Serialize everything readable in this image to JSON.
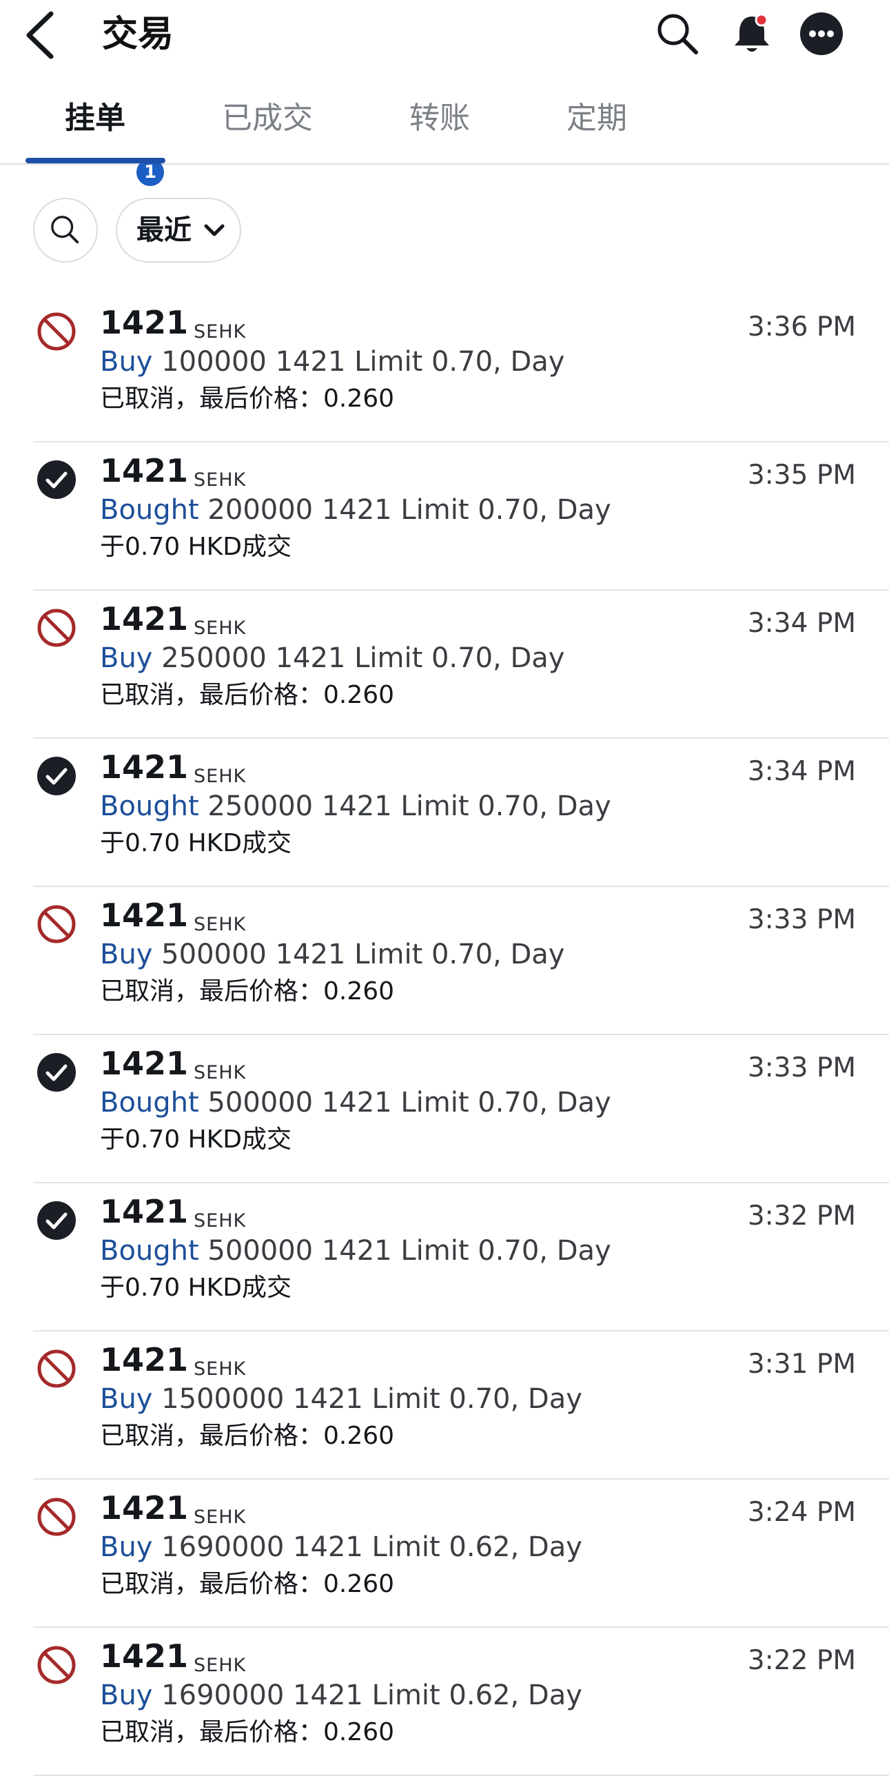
{
  "header": {
    "title": "交易"
  },
  "tabs": [
    {
      "label": "挂单",
      "active": true,
      "badge": "1"
    },
    {
      "label": "已成交",
      "active": false
    },
    {
      "label": "转账",
      "active": false
    },
    {
      "label": "定期",
      "active": false
    }
  ],
  "filters": {
    "period_label": "最近"
  },
  "colors": {
    "accent_blue": "#1c4f9a",
    "cancelled_red": "#a52a2a",
    "filled_black": "#1b1e24",
    "badge_blue": "#1c5fc4"
  },
  "icons": {
    "back": "chevron-left-icon",
    "search": "search-icon",
    "bell": "bell-icon",
    "more": "more-dots-icon",
    "cancelled": "prohibited-icon",
    "filled": "check-circle-icon"
  },
  "orders": [
    {
      "status": "cancelled",
      "symbol": "1421",
      "exchange": "SEHK",
      "time": "3:36 PM",
      "action": "Buy",
      "details": " 100000 1421 Limit 0.70, Day",
      "note": "已取消，最后价格：0.260"
    },
    {
      "status": "filled",
      "symbol": "1421",
      "exchange": "SEHK",
      "time": "3:35 PM",
      "action": "Bought",
      "details": " 200000 1421 Limit 0.70, Day",
      "note": "于0.70 HKD成交"
    },
    {
      "status": "cancelled",
      "symbol": "1421",
      "exchange": "SEHK",
      "time": "3:34 PM",
      "action": "Buy",
      "details": " 250000 1421 Limit 0.70, Day",
      "note": "已取消，最后价格：0.260"
    },
    {
      "status": "filled",
      "symbol": "1421",
      "exchange": "SEHK",
      "time": "3:34 PM",
      "action": "Bought",
      "details": " 250000 1421 Limit 0.70, Day",
      "note": "于0.70 HKD成交"
    },
    {
      "status": "cancelled",
      "symbol": "1421",
      "exchange": "SEHK",
      "time": "3:33 PM",
      "action": "Buy",
      "details": " 500000 1421 Limit 0.70, Day",
      "note": "已取消，最后价格：0.260"
    },
    {
      "status": "filled",
      "symbol": "1421",
      "exchange": "SEHK",
      "time": "3:33 PM",
      "action": "Bought",
      "details": " 500000 1421 Limit 0.70, Day",
      "note": "于0.70 HKD成交"
    },
    {
      "status": "filled",
      "symbol": "1421",
      "exchange": "SEHK",
      "time": "3:32 PM",
      "action": "Bought",
      "details": " 500000 1421 Limit 0.70, Day",
      "note": "于0.70 HKD成交"
    },
    {
      "status": "cancelled",
      "symbol": "1421",
      "exchange": "SEHK",
      "time": "3:31 PM",
      "action": "Buy",
      "details": " 1500000 1421 Limit 0.70, Day",
      "note": "已取消，最后价格：0.260"
    },
    {
      "status": "cancelled",
      "symbol": "1421",
      "exchange": "SEHK",
      "time": "3:24 PM",
      "action": "Buy",
      "details": " 1690000 1421 Limit 0.62, Day",
      "note": "已取消，最后价格：0.260"
    },
    {
      "status": "cancelled",
      "symbol": "1421",
      "exchange": "SEHK",
      "time": "3:22 PM",
      "action": "Buy",
      "details": " 1690000 1421 Limit 0.62, Day",
      "note": "已取消，最后价格：0.260"
    }
  ]
}
